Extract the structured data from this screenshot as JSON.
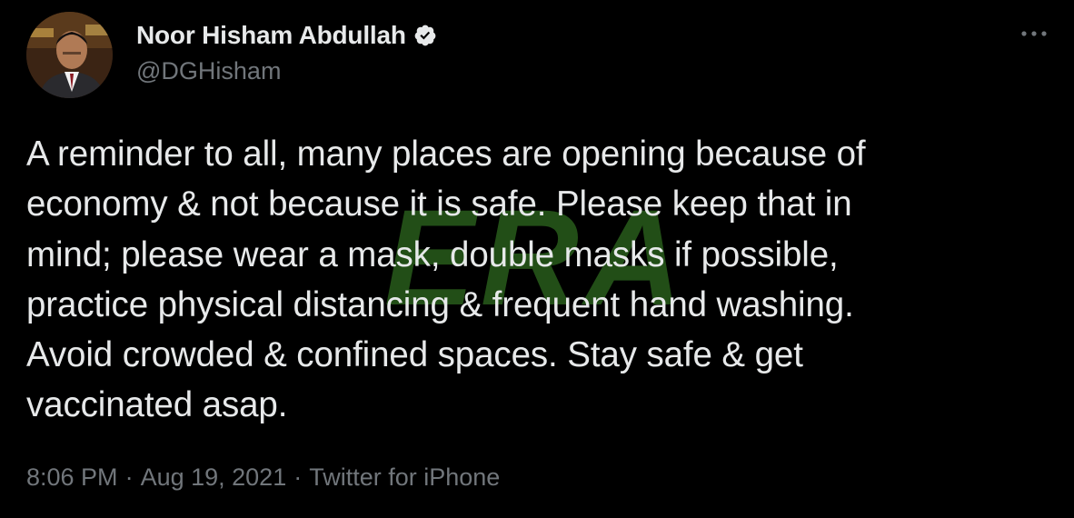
{
  "tweet": {
    "author": {
      "display_name": "Noor Hisham Abdullah",
      "handle": "@DGHisham",
      "verified": true,
      "avatar_icon": "profile-photo"
    },
    "more_icon": "ellipsis-icon",
    "text": "A reminder to all, many places are opening because of\neconomy & not because it is safe. Please keep that in\nmind; please wear a mask, double masks if possible,\npractice physical distancing & frequent hand washing.\nAvoid crowded & confined spaces. Stay safe & get\nvaccinated asap.",
    "watermark_text": "ERA",
    "time": "8:06 PM",
    "date": "Aug 19, 2021",
    "separator": "·",
    "source": "Twitter for iPhone"
  },
  "colors": {
    "background": "#000000",
    "primary_text": "#e7e9ea",
    "secondary_text": "#71767b",
    "watermark_green": "#3f8f2a"
  }
}
